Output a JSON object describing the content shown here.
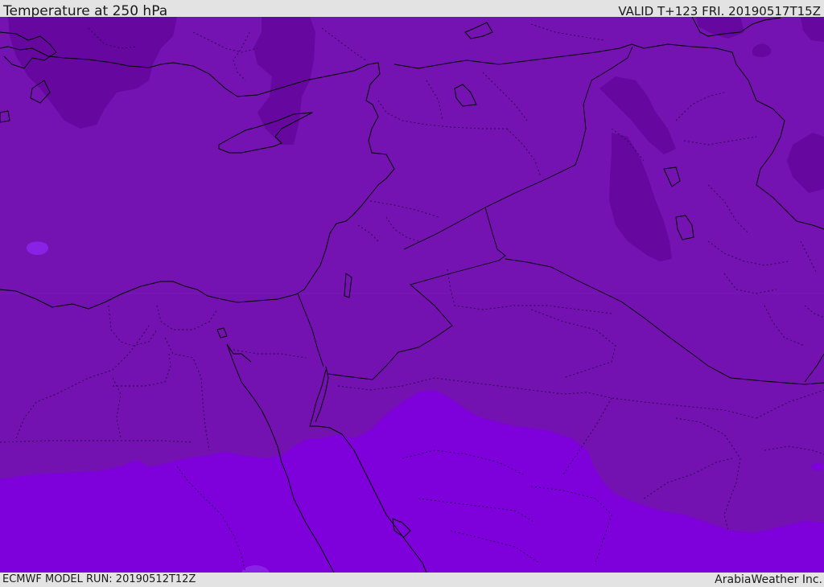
{
  "header": {
    "title": "Temperature at 250 hPa",
    "valid": "VALID T+123 FRI. 20190517T15Z"
  },
  "footer": {
    "run": "ECMWF MODEL RUN: 20190512T12Z",
    "brand": "ArabiaWeather Inc."
  },
  "colors": {
    "base": "#7512b2",
    "cold": "#6607a0",
    "coldest": "#5c0896",
    "warm": "#7e00db",
    "spot": "#8a22e6",
    "border": "#000000",
    "bar": "#e3e3e3"
  }
}
